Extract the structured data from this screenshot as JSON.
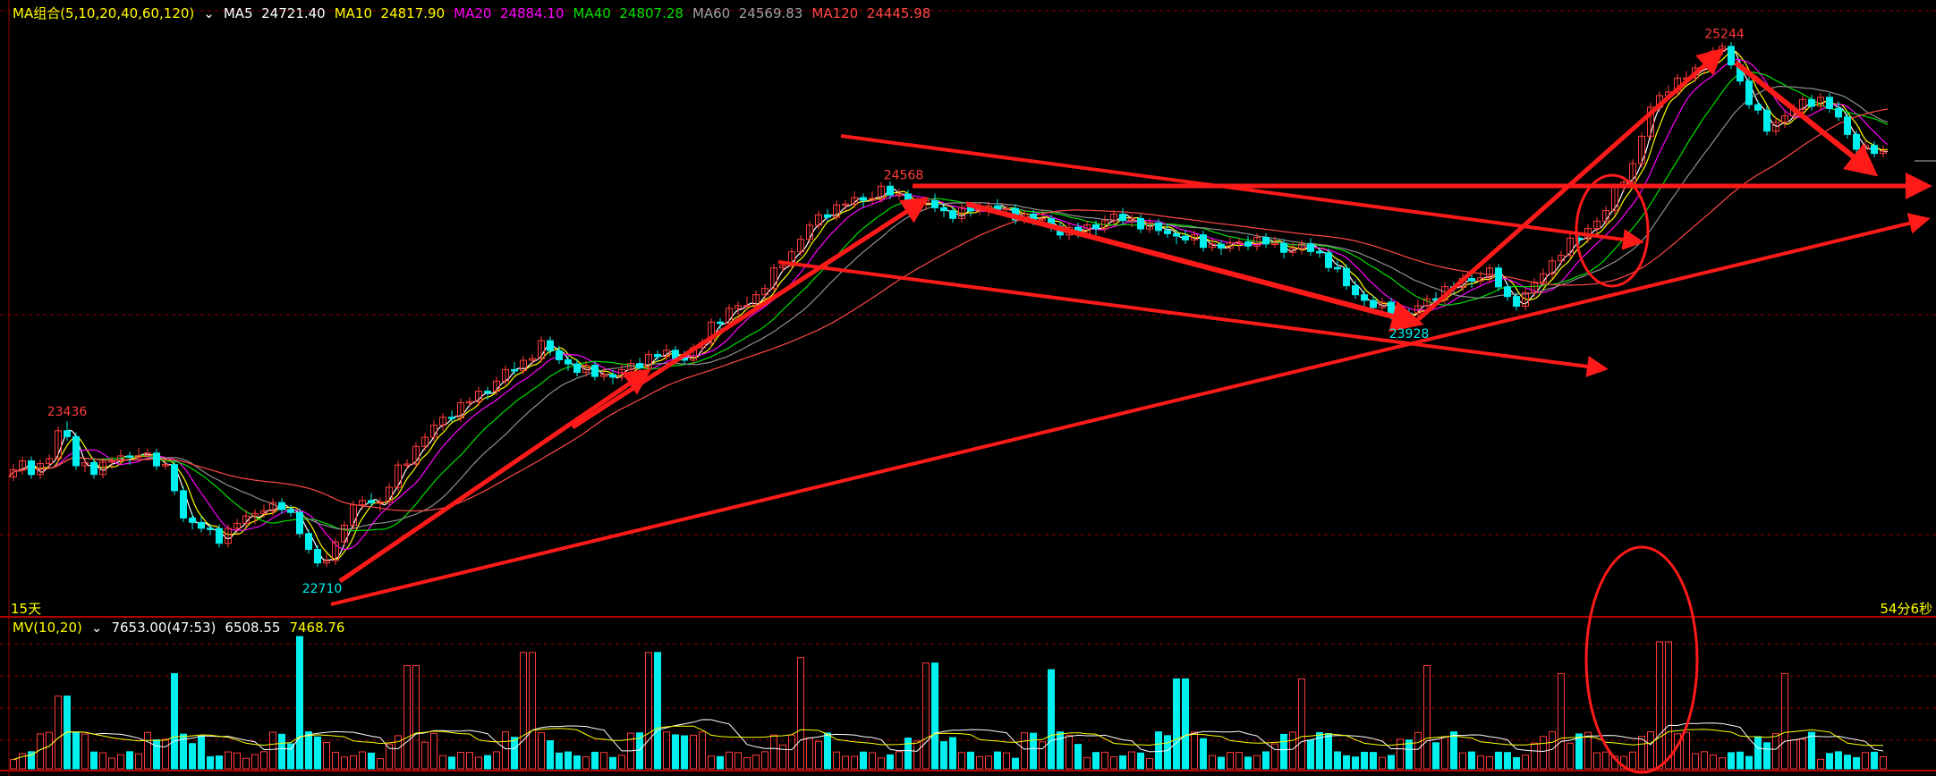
{
  "colors": {
    "up": "#ff3c3c",
    "down": "#00f0f0",
    "ma5": "#ffffff",
    "ma10": "#ffff00",
    "ma20": "#ff00ff",
    "ma40": "#00e000",
    "ma60": "#909090",
    "ma120": "#ff4848",
    "annotation": "#ff1a1a",
    "grid": "#8b0000"
  },
  "ma_legend": {
    "title": "MA组合(5,10,20,40,60,120)",
    "ma5": "MA5  24721.40",
    "ma10": "MA10  24817.90",
    "ma20": "MA20  24884.10",
    "ma40": "MA40  24807.28",
    "ma60": "MA60  24569.83",
    "ma120": "MA120  24445.98"
  },
  "vol_legend": {
    "title": "MV(10,20)",
    "value": "7653.00(47:53)",
    "mv10": "6508.55",
    "mv20": "7468.76"
  },
  "timeframe_label": "15天",
  "countdown": "54分6秒",
  "chart_data": {
    "type": "candlestick",
    "price_axis": {
      "ylim": [
        22500,
        25400
      ],
      "gridlines": [
        24000,
        23000
      ]
    },
    "annotations": [
      {
        "label": "23436",
        "x": 26,
        "y": 23436
      },
      {
        "label": "22710",
        "x": 140,
        "y": 22710
      },
      {
        "label": "24568",
        "x": 400,
        "y": 24568
      },
      {
        "label": "23928",
        "x": 626,
        "y": 23928
      },
      {
        "label": "25244",
        "x": 767,
        "y": 25244
      }
    ],
    "keypoints": [
      [
        0,
        23170
      ],
      [
        8,
        23230
      ],
      [
        14,
        23200
      ],
      [
        20,
        23260
      ],
      [
        26,
        23436
      ],
      [
        32,
        23240
      ],
      [
        40,
        23190
      ],
      [
        48,
        23270
      ],
      [
        56,
        23250
      ],
      [
        62,
        23300
      ],
      [
        68,
        23240
      ],
      [
        74,
        23180
      ],
      [
        80,
        22980
      ],
      [
        90,
        22910
      ],
      [
        96,
        22880
      ],
      [
        104,
        22950
      ],
      [
        110,
        22980
      ],
      [
        116,
        23030
      ],
      [
        124,
        23020
      ],
      [
        130,
        22970
      ],
      [
        136,
        22820
      ],
      [
        140,
        22740
      ],
      [
        146,
        22800
      ],
      [
        152,
        22960
      ],
      [
        160,
        23060
      ],
      [
        168,
        23050
      ],
      [
        176,
        23200
      ],
      [
        186,
        23340
      ],
      [
        196,
        23450
      ],
      [
        206,
        23520
      ],
      [
        214,
        23580
      ],
      [
        222,
        23650
      ],
      [
        230,
        23700
      ],
      [
        240,
        23800
      ],
      [
        248,
        23740
      ],
      [
        256,
        23680
      ],
      [
        264,
        23670
      ],
      [
        272,
        23650
      ],
      [
        280,
        23700
      ],
      [
        288,
        23740
      ],
      [
        296,
        23760
      ],
      [
        304,
        23740
      ],
      [
        310,
        23780
      ],
      [
        316,
        23900
      ],
      [
        324,
        23960
      ],
      [
        332,
        24000
      ],
      [
        338,
        24060
      ],
      [
        344,
        24140
      ],
      [
        352,
        24250
      ],
      [
        360,
        24370
      ],
      [
        368,
        24440
      ],
      [
        376,
        24480
      ],
      [
        384,
        24500
      ],
      [
        392,
        24540
      ],
      [
        400,
        24510
      ],
      [
        406,
        24470
      ],
      [
        414,
        24480
      ],
      [
        420,
        24440
      ],
      [
        426,
        24420
      ],
      [
        432,
        24450
      ],
      [
        440,
        24470
      ],
      [
        448,
        24430
      ],
      [
        456,
        24420
      ],
      [
        464,
        24390
      ],
      [
        472,
        24350
      ],
      [
        480,
        24340
      ],
      [
        488,
        24380
      ],
      [
        496,
        24410
      ],
      [
        504,
        24400
      ],
      [
        512,
        24360
      ],
      [
        520,
        24340
      ],
      [
        528,
        24310
      ],
      [
        536,
        24290
      ],
      [
        544,
        24270
      ],
      [
        550,
        24280
      ],
      [
        556,
        24300
      ],
      [
        562,
        24300
      ],
      [
        570,
        24260
      ],
      [
        578,
        24270
      ],
      [
        586,
        24250
      ],
      [
        594,
        24180
      ],
      [
        600,
        24080
      ],
      [
        610,
        24000
      ],
      [
        620,
        23960
      ],
      [
        626,
        23950
      ],
      [
        634,
        23990
      ],
      [
        642,
        24060
      ],
      [
        650,
        24090
      ],
      [
        656,
        24120
      ],
      [
        664,
        24150
      ],
      [
        672,
        24020
      ],
      [
        678,
        24010
      ],
      [
        686,
        24120
      ],
      [
        694,
        24230
      ],
      [
        702,
        24300
      ],
      [
        710,
        24380
      ],
      [
        716,
        24440
      ],
      [
        722,
        24580
      ],
      [
        728,
        24660
      ],
      [
        734,
        24880
      ],
      [
        740,
        25000
      ],
      [
        748,
        25060
      ],
      [
        756,
        25110
      ],
      [
        762,
        25180
      ],
      [
        767,
        25230
      ],
      [
        770,
        25190
      ],
      [
        776,
        25060
      ],
      [
        782,
        24930
      ],
      [
        788,
        24830
      ],
      [
        794,
        24890
      ],
      [
        800,
        24930
      ],
      [
        806,
        24960
      ],
      [
        812,
        24980
      ],
      [
        818,
        24920
      ],
      [
        822,
        24830
      ],
      [
        828,
        24760
      ],
      [
        834,
        24730
      ],
      [
        840,
        24710
      ]
    ],
    "volume_peaks": [
      {
        "x": 24,
        "ratio": 0.55
      },
      {
        "x": 74,
        "ratio": 0.72
      },
      {
        "x": 130,
        "ratio": 1.0
      },
      {
        "x": 180,
        "ratio": 0.78
      },
      {
        "x": 232,
        "ratio": 0.88
      },
      {
        "x": 288,
        "ratio": 0.88
      },
      {
        "x": 300,
        "ratio": 0.25
      },
      {
        "x": 354,
        "ratio": 0.84
      },
      {
        "x": 412,
        "ratio": 0.8
      },
      {
        "x": 466,
        "ratio": 0.75
      },
      {
        "x": 524,
        "ratio": 0.68
      },
      {
        "x": 578,
        "ratio": 0.68
      },
      {
        "x": 634,
        "ratio": 0.78
      },
      {
        "x": 694,
        "ratio": 0.72
      },
      {
        "x": 740,
        "ratio": 0.96
      },
      {
        "x": 794,
        "ratio": 0.72
      }
    ]
  }
}
